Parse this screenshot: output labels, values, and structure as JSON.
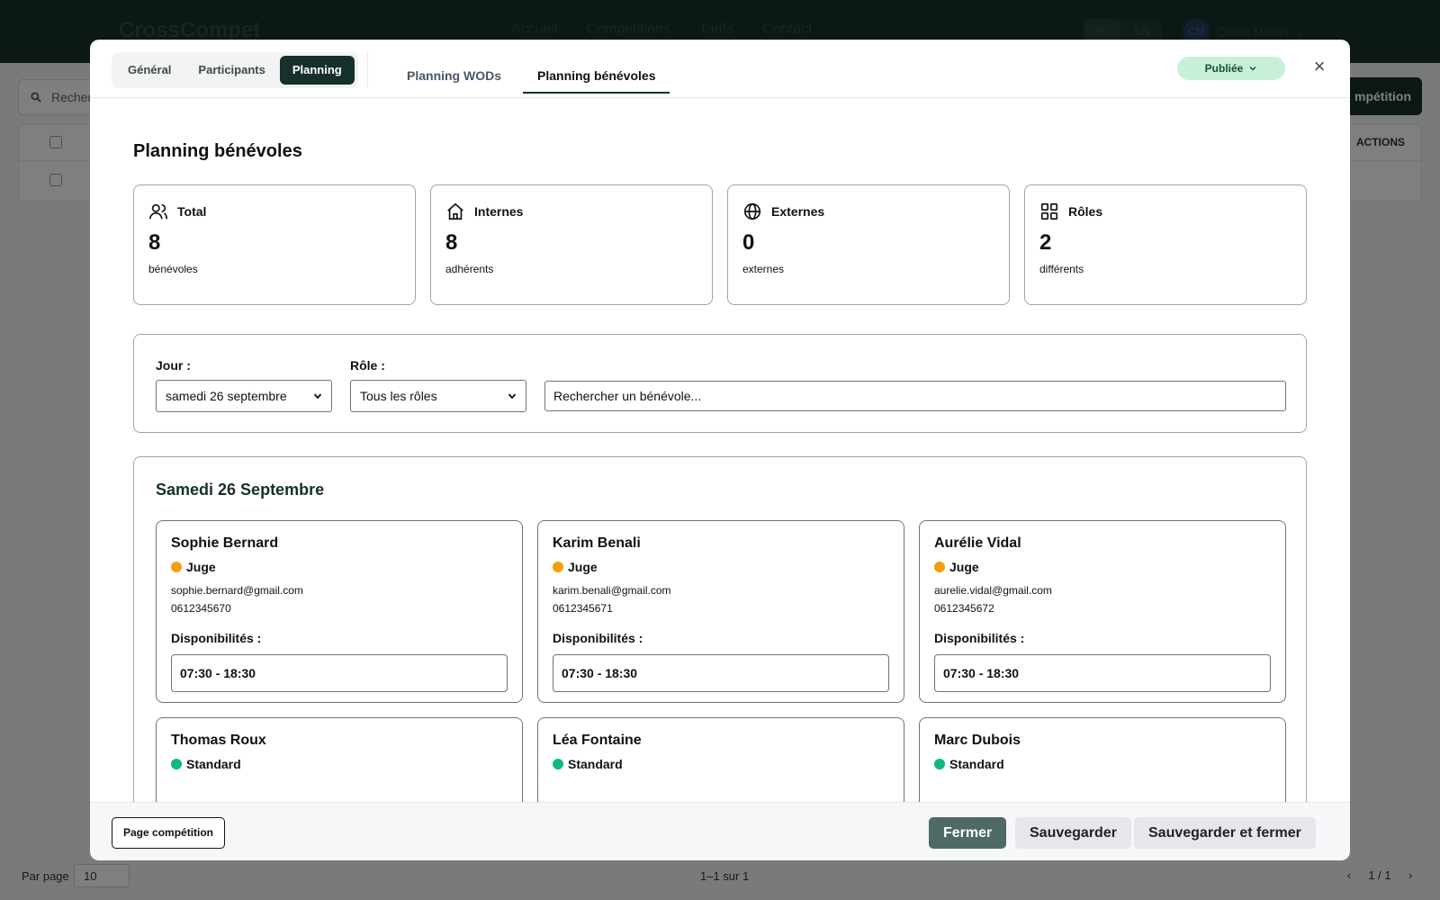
{
  "app": {
    "brand": "CrossCompet",
    "nav": [
      "Accueil",
      "Compétitions",
      "Tarifs",
      "Contact"
    ],
    "languages": [
      "FR",
      "EN"
    ],
    "user_initials": "CM",
    "user_name": "Claire Martin",
    "search_placeholder": "Recher",
    "new_button_label": "mpétition",
    "table_actions_header": "ACTIONS",
    "per_page_label": "Par page",
    "per_page_value": "10",
    "range_text": "1–1 sur 1",
    "page_text": "1 / 1"
  },
  "modal": {
    "main_tabs": [
      {
        "label": "Général",
        "active": false
      },
      {
        "label": "Participants",
        "active": false
      },
      {
        "label": "Planning",
        "active": true
      }
    ],
    "sub_tabs": [
      {
        "label": "Planning WODs",
        "active": false
      },
      {
        "label": "Planning bénévoles",
        "active": true
      }
    ],
    "status": "Publiée",
    "close_glyph": "×",
    "title": "Planning bénévoles",
    "stats": [
      {
        "icon": "users-icon",
        "label": "Total",
        "value": "8",
        "sub": "bénévoles"
      },
      {
        "icon": "home-icon",
        "label": "Internes",
        "value": "8",
        "sub": "adhérents"
      },
      {
        "icon": "globe-icon",
        "label": "Externes",
        "value": "0",
        "sub": "externes"
      },
      {
        "icon": "grid-icon",
        "label": "Rôles",
        "value": "2",
        "sub": "différents"
      }
    ],
    "filters": {
      "day_label": "Jour :",
      "day_value": "samedi 26 septembre",
      "role_label": "Rôle :",
      "role_value": "Tous les rôles",
      "search_placeholder": "Rechercher un bénévole..."
    },
    "day": {
      "title": "Samedi 26 Septembre",
      "availability_label": "Disponibilités :",
      "volunteers": [
        {
          "name": "Sophie Bernard",
          "role": "Juge",
          "role_color": "#f59e0b",
          "email": "sophie.bernard@gmail.com",
          "phone": "0612345670",
          "slot": "07:30 - 18:30"
        },
        {
          "name": "Karim Benali",
          "role": "Juge",
          "role_color": "#f59e0b",
          "email": "karim.benali@gmail.com",
          "phone": "0612345671",
          "slot": "07:30 - 18:30"
        },
        {
          "name": "Aurélie Vidal",
          "role": "Juge",
          "role_color": "#f59e0b",
          "email": "aurelie.vidal@gmail.com",
          "phone": "0612345672",
          "slot": "07:30 - 18:30"
        },
        {
          "name": "Thomas Roux",
          "role": "Standard",
          "role_color": "#10b981"
        },
        {
          "name": "Léa Fontaine",
          "role": "Standard",
          "role_color": "#10b981"
        },
        {
          "name": "Marc Dubois",
          "role": "Standard",
          "role_color": "#10b981"
        }
      ]
    },
    "footer": {
      "page_button": "Page compétition",
      "close_button": "Fermer",
      "save_button": "Sauvegarder",
      "save_close_button": "Sauvegarder et fermer"
    }
  }
}
